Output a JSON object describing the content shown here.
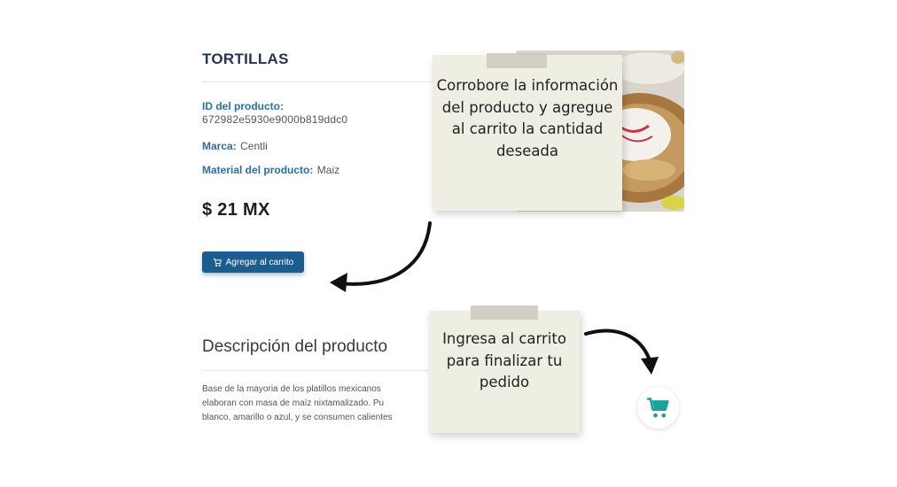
{
  "product": {
    "title": "TORTILLAS",
    "id_label": "ID del producto:",
    "id_value": "672982e5930e9000b819ddc0",
    "brand_label": "Marca:",
    "brand_value": "Centli",
    "material_label": "Material del producto:",
    "material_value": "Maiz",
    "price": "$ 21 MX",
    "add_button_label": "Agregar al carrito",
    "add_button_icon": "cart-icon"
  },
  "description": {
    "title": "Descripción del producto",
    "lines": [
      "Base de la mayoria de los platillos mexicanos",
      "elaboran con masa de maíz nixtamalizado. Pu",
      "blanco, amarillo o azul, y se consumen calientes"
    ]
  },
  "notes": {
    "note1": "Corrobore la información del producto y agregue al carrito la cantidad deseada",
    "note2": "Ingresa al carrito para finalizar tu pedido"
  },
  "cart_fab": {
    "icon": "cart-icon",
    "color": "#1aa39c"
  },
  "colors": {
    "accent": "#1c5d8f",
    "title": "#1f3550",
    "label": "#2c6f9e",
    "note": "#efeee3"
  }
}
